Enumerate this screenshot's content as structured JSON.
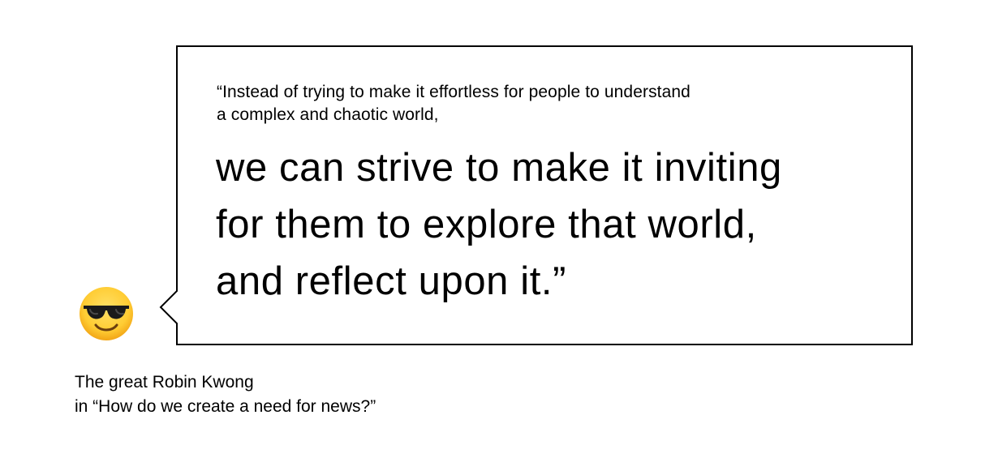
{
  "quote": {
    "intro_lines": [
      "“Instead of trying to make it effortless for people to understand",
      "a complex and chaotic world,"
    ],
    "emphasis_lines": [
      "we can strive to make it inviting",
      "for them to explore that world,",
      "and reflect upon it.”"
    ]
  },
  "speaker": {
    "avatar_icon": "smiling-face-with-sunglasses-icon"
  },
  "attribution": {
    "line1": "The great Robin Kwong",
    "line2": "in “How do we create a need for news?”"
  },
  "colors": {
    "text": "#000000",
    "border": "#000000",
    "background": "#ffffff",
    "emoji_face": "#ffcc33",
    "emoji_glasses": "#1a1a1a"
  }
}
